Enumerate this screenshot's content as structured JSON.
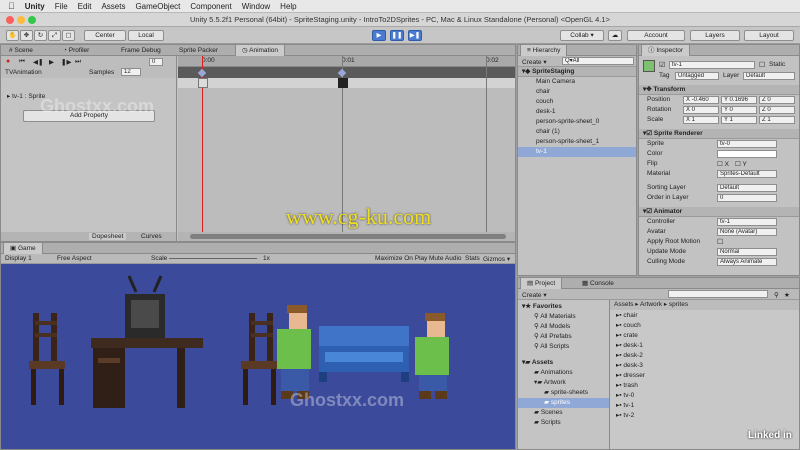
{
  "menubar": {
    "apple": "",
    "items": [
      "Unity",
      "File",
      "Edit",
      "Assets",
      "GameObject",
      "Component",
      "Window",
      "Help"
    ]
  },
  "window_title": "Unity 5.5.2f1 Personal (64bit) - SpriteStaging.unity - IntroTo2DSprites - PC, Mac & Linux Standalone (Personal) <OpenGL 4.1>",
  "toolbar": {
    "pivot": "Center",
    "space": "Local",
    "collab": "Collab ▾",
    "account": "Account",
    "layers": "Layers",
    "layout": "Layout"
  },
  "top_tabs": [
    "Scene",
    "Profiler",
    "Frame Debug",
    "Sprite Packer",
    "Animation"
  ],
  "animation": {
    "clip": "TVAnimation",
    "samples_label": "Samples",
    "samples_value": "12",
    "frame": "0",
    "property": "tv-1 : Sprite",
    "add_property": "Add Property",
    "time_labels": [
      "0:00",
      "0:01",
      "0:02"
    ],
    "bottom_tabs": [
      "Dopesheet",
      "Curves"
    ]
  },
  "hierarchy": {
    "tab": "Hierarchy",
    "create": "Create ▾",
    "search_placeholder": "Q▾All",
    "scene": "SpriteStaging",
    "items": [
      "Main Camera",
      "chair",
      "couch",
      "desk-1",
      "person-sprite-sheet_0",
      "chair (1)",
      "person-sprite-sheet_1",
      "tv-1"
    ]
  },
  "inspector": {
    "tab": "Inspector",
    "object_name": "tv-1",
    "static_label": "Static",
    "tag_label": "Tag",
    "tag_value": "Untagged",
    "layer_label": "Layer",
    "layer_value": "Default",
    "transform": {
      "title": "Transform",
      "position_label": "Position",
      "rotation_label": "Rotation",
      "scale_label": "Scale",
      "position": [
        "X -0.460",
        "Y 0.1696",
        "Z 0"
      ],
      "rotation": [
        "X 0",
        "Y 0",
        "Z 0"
      ],
      "scale": [
        "X 1",
        "Y 1",
        "Z 1"
      ]
    },
    "sprite_renderer": {
      "title": "Sprite Renderer",
      "sprite_label": "Sprite",
      "sprite_value": "tv-0",
      "color_label": "Color",
      "flip_label": "Flip",
      "flip_x": "X",
      "flip_y": "Y",
      "material_label": "Material",
      "material_value": "Sprites-Default",
      "sorting_label": "Sorting Layer",
      "sorting_value": "Default",
      "order_label": "Order in Layer",
      "order_value": "0"
    },
    "animator": {
      "title": "Animator",
      "controller_label": "Controller",
      "controller_value": "tv-1",
      "avatar_label": "Avatar",
      "avatar_value": "None (Avatar)",
      "root_motion_label": "Apply Root Motion",
      "update_label": "Update Mode",
      "update_value": "Normal",
      "culling_label": "Culling Mode",
      "culling_value": "Always Animate"
    }
  },
  "game": {
    "tab": "Game",
    "display": "Display 1",
    "aspect": "Free Aspect",
    "scale_label": "Scale",
    "scale_value": "1x",
    "options": [
      "Maximize On Play",
      "Mute Audio",
      "Stats",
      "Gizmos ▾"
    ]
  },
  "project": {
    "tabs": [
      "Project",
      "Console"
    ],
    "create": "Create ▾",
    "favorites_title": "Favorites",
    "favorites": [
      "All Materials",
      "All Models",
      "All Prefabs",
      "All Scripts"
    ],
    "assets_title": "Assets",
    "assets_tree": [
      "Animations",
      "Artwork",
      "sprite-sheets",
      "sprites",
      "Scenes",
      "Scripts"
    ],
    "breadcrumb": "Assets ▸ Artwork ▸ sprites",
    "files": [
      "chair",
      "couch",
      "crate",
      "desk-1",
      "desk-2",
      "desk-3",
      "dresser",
      "trash",
      "tv-0",
      "tv-1",
      "tv-2"
    ]
  },
  "overlay": {
    "site": "www.cg-ku.com",
    "watermark": "Ghostxx.com",
    "brand": "Linked in"
  },
  "colors": {
    "game_bg": "#3b4a9a",
    "accent": "#4a7bd0",
    "selection": "#8fa8d6"
  }
}
